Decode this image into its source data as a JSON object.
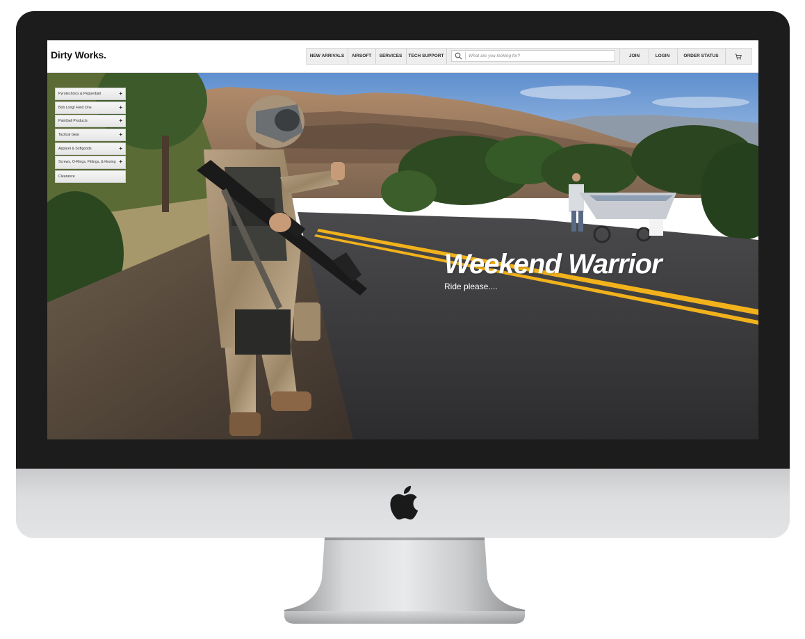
{
  "brand": {
    "name": "Dirty Works."
  },
  "nav": {
    "items": [
      {
        "label": "NEW ARRIVALS"
      },
      {
        "label": "AIRSOFT"
      },
      {
        "label": "SERVICES"
      },
      {
        "label": "TECH SUPPORT"
      }
    ],
    "search": {
      "placeholder": "What are you looking for?",
      "value": "",
      "icon": "search-icon"
    },
    "right_items": [
      {
        "label": "JOIN"
      },
      {
        "label": "LOGIN"
      },
      {
        "label": "ORDER STATUS"
      }
    ],
    "cart_icon": "cart-icon"
  },
  "sidebar": {
    "items": [
      {
        "label": "Pyrotechnics & Pepperball",
        "expand": "+"
      },
      {
        "label": "Bob Long/ Field One",
        "expand": "+"
      },
      {
        "label": "Paintball Products",
        "expand": "+"
      },
      {
        "label": "Tactical Gear",
        "expand": "+"
      },
      {
        "label": "Apparel & Softgoods",
        "expand": "+"
      },
      {
        "label": "Screws, O-Rings, Fittings, & Hosing",
        "expand": "+"
      },
      {
        "label": "Clearance",
        "expand": ""
      }
    ]
  },
  "hero": {
    "title": "Weekend Warrior",
    "subtitle": "Ride please...."
  },
  "colors": {
    "bezel": "#1c1c1c",
    "road": "#3a3a3c",
    "road_line": "#f2b21b",
    "sky": "#7fa7d6"
  }
}
